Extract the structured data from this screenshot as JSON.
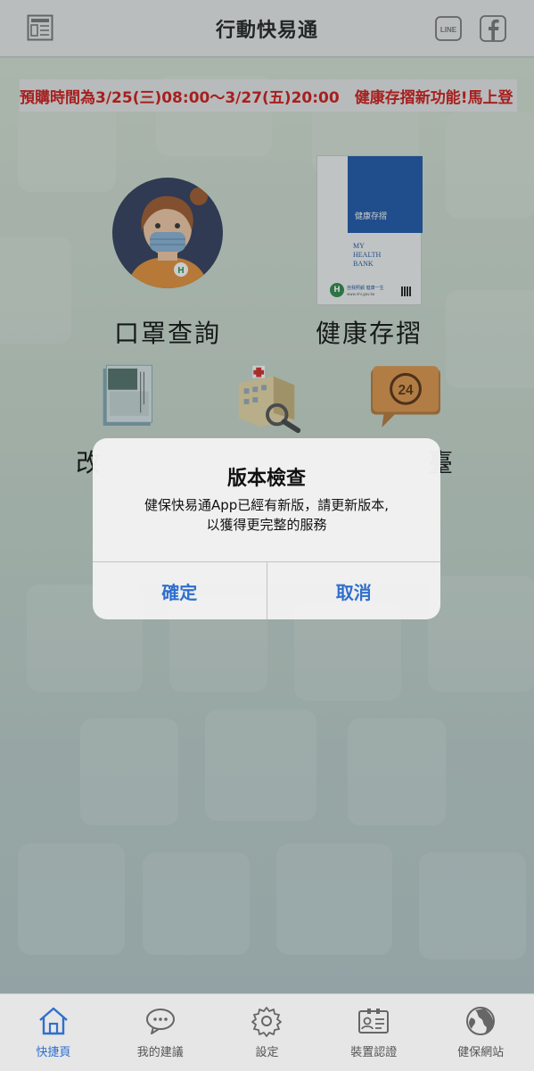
{
  "header": {
    "title": "行動快易通",
    "line_label": "LINE"
  },
  "marquee": {
    "text": "預購時間為3/25(三)08:00～3/27(五)20:00　健康存摺新功能!馬上登"
  },
  "features": {
    "mask_query": "口罩查詢",
    "health_bank": "健康存摺",
    "item3_partial": "改",
    "item5_partial": "臺"
  },
  "health_bank_book": {
    "title": "健康存摺",
    "subtitle_line1": "MY",
    "subtitle_line2": "HEALTH",
    "subtitle_line3": "BANK",
    "footer": "自我照顧 健康一生",
    "url": "www.nhi.gov.tw"
  },
  "clock_badge": "24",
  "dialog": {
    "title": "版本檢查",
    "message_line1": "健保快易通App已經有新版，請更新版本,",
    "message_line2": "以獲得更完整的服務",
    "confirm": "確定",
    "cancel": "取消"
  },
  "tabs": [
    {
      "label": "快捷頁",
      "icon": "home-icon",
      "active": true
    },
    {
      "label": "我的建議",
      "icon": "chat-icon",
      "active": false
    },
    {
      "label": "設定",
      "icon": "gear-icon",
      "active": false
    },
    {
      "label": "裝置認證",
      "icon": "id-card-icon",
      "active": false
    },
    {
      "label": "健保網站",
      "icon": "globe-icon",
      "active": false
    }
  ],
  "colors": {
    "accent": "#2f6fce",
    "marquee_text": "#d21919",
    "book_blue": "#1e56a8"
  }
}
